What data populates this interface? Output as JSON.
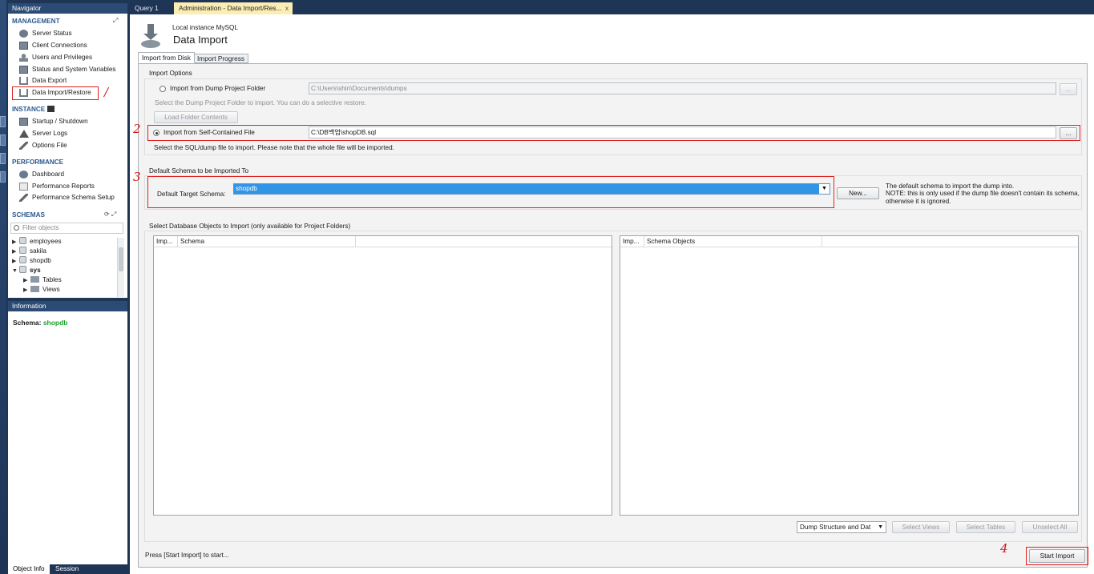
{
  "navigator": {
    "title": "Navigator",
    "management_title": "MANAGEMENT",
    "management": [
      "Server Status",
      "Client Connections",
      "Users and Privileges",
      "Status and System Variables",
      "Data Export",
      "Data Import/Restore"
    ],
    "instance_title": "INSTANCE",
    "instance": [
      "Startup / Shutdown",
      "Server Logs",
      "Options File"
    ],
    "performance_title": "PERFORMANCE",
    "performance": [
      "Dashboard",
      "Performance Reports",
      "Performance Schema Setup"
    ],
    "schemas_title": "SCHEMAS",
    "filter_placeholder": "Filter objects",
    "schemas": [
      "employees",
      "sakila",
      "shopdb",
      "sys"
    ],
    "sys_children": [
      "Tables",
      "Views"
    ]
  },
  "information": {
    "title": "Information",
    "schema_label": "Schema:",
    "schema_value": "shopdb"
  },
  "bottom_tabs": [
    "Object Info",
    "Session"
  ],
  "tabs": {
    "query": "Query 1",
    "admin": "Administration - Data Import/Res...",
    "close": "x"
  },
  "header": {
    "subtitle": "Local instance MySQL",
    "title": "Data Import"
  },
  "page_tabs": [
    "Import from Disk",
    "Import Progress"
  ],
  "import_options": {
    "title": "Import Options",
    "dump_folder_label": "Import from Dump Project Folder",
    "dump_folder_path": "C:\\Users\\shin\\Documents\\dumps",
    "dump_folder_hint": "Select the Dump Project Folder to import. You can do a selective restore.",
    "load_folder_btn": "Load Folder Contents",
    "self_file_label": "Import from Self-Contained File",
    "self_file_path": "C:\\DB백업\\shopDB.sql",
    "self_file_hint": "Select the SQL/dump file to import. Please note that the whole file will be imported.",
    "browse_btn": "..."
  },
  "default_schema": {
    "title": "Default Schema to be Imported To",
    "label": "Default Target Schema:",
    "value": "shopdb",
    "new_btn": "New...",
    "note1": "The default schema to import the dump into.",
    "note2": "NOTE: this is only used if the dump file doesn't contain its schema,",
    "note3": "otherwise it is ignored."
  },
  "db_objects": {
    "title": "Select Database Objects to Import (only available for Project Folders)",
    "left_cols": [
      "Imp...",
      "Schema"
    ],
    "right_cols": [
      "Imp...",
      "Schema Objects"
    ],
    "dump_type": "Dump Structure and Dat",
    "select_views": "Select Views",
    "select_tables": "Select Tables",
    "unselect_all": "Unselect All"
  },
  "footer": {
    "status": "Press [Start Import] to start...",
    "start_btn": "Start Import"
  },
  "annotations": [
    "/",
    "2",
    "3",
    "4"
  ],
  "colors": {
    "accent_blue": "#3195e6",
    "tab_active": "#fbedb4",
    "annotation_red": "#e02020",
    "schema_green": "#1f9e2e"
  }
}
